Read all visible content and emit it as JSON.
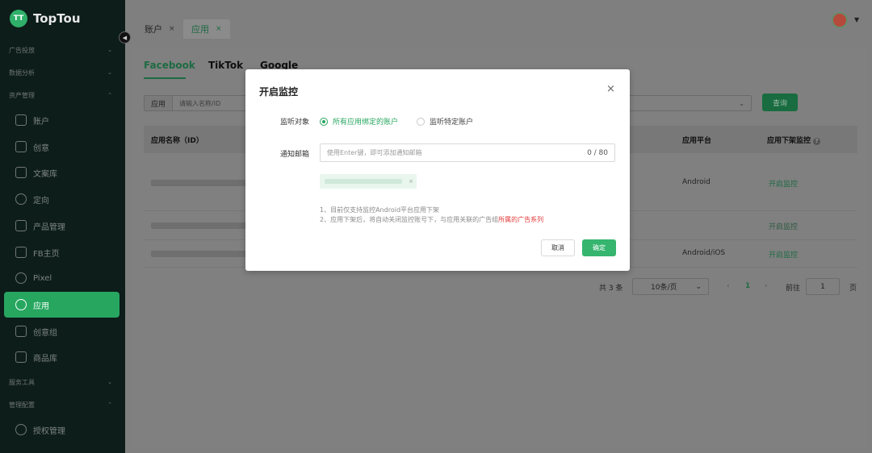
{
  "app": {
    "name": "TopTou",
    "logo_mark": "TT"
  },
  "sidebar": {
    "groups": [
      {
        "label": "广告投放",
        "chevron": "⌄"
      },
      {
        "label": "数据分析",
        "chevron": "⌄"
      },
      {
        "label": "资产管理",
        "chevron": "⌃"
      },
      {
        "label": "服务工具",
        "chevron": "⌄"
      },
      {
        "label": "管理配置",
        "chevron": "⌃"
      }
    ],
    "items": [
      {
        "label": "账户",
        "icon": "account-icon"
      },
      {
        "label": "创意",
        "icon": "creative-icon"
      },
      {
        "label": "文案库",
        "icon": "copy-library-icon"
      },
      {
        "label": "定向",
        "icon": "targeting-icon"
      },
      {
        "label": "产品管理",
        "icon": "product-icon"
      },
      {
        "label": "FB主页",
        "icon": "fb-page-icon"
      },
      {
        "label": "Pixel",
        "icon": "pixel-icon"
      },
      {
        "label": "应用",
        "icon": "app-icon"
      },
      {
        "label": "创意组",
        "icon": "creative-group-icon"
      },
      {
        "label": "商品库",
        "icon": "catalog-icon"
      },
      {
        "label": "授权管理",
        "icon": "shield-icon"
      }
    ],
    "active_item": "应用"
  },
  "tabs": [
    {
      "label": "账户",
      "close": "×"
    },
    {
      "label": "应用",
      "close": "×"
    }
  ],
  "platform_tabs": [
    "Facebook",
    "TikTok",
    "Google"
  ],
  "filter": {
    "label": "应用",
    "placeholder": "请输入名称/ID",
    "query_button": "查询",
    "select_arrow": "⌄"
  },
  "table": {
    "headers": {
      "name": "应用名称（ID）",
      "platform": "应用平台",
      "monitor": "应用下架监控",
      "help": "?"
    },
    "rows": [
      {
        "platform": "Android",
        "action": "开启监控"
      },
      {
        "platform": "",
        "action": "开启监控"
      },
      {
        "platform": "Android/iOS",
        "action": "开启监控"
      }
    ]
  },
  "pagination": {
    "total": "共 3 条",
    "page_size": "10条/页",
    "page_size_arrow": "⌄",
    "prev": "‹",
    "current": "1",
    "next": "›",
    "goto_label": "前往",
    "goto_value": "1",
    "goto_unit": "页"
  },
  "modal": {
    "title": "开启监控",
    "close": "×",
    "listen_label": "监听对象",
    "options": [
      "所有应用绑定的账户",
      "监听特定账户"
    ],
    "email_label": "通知邮箱",
    "email_placeholder": "使用Enter键，即可添加通知邮箱",
    "email_count": "0 / 80",
    "tag_close": "×",
    "note1": "1、目前仅支持监控Android平台应用下架",
    "note2_prefix": "2、应用下架后，将自动关闭监控账号下，与应用关联的广告组",
    "note2_highlight": "所属的广告系列",
    "cancel": "取消",
    "confirm": "确定"
  },
  "colors": {
    "brand_green": "#27a660",
    "sidebar_bg": "#0d1d1a",
    "highlight_red": "#e43a3a"
  }
}
